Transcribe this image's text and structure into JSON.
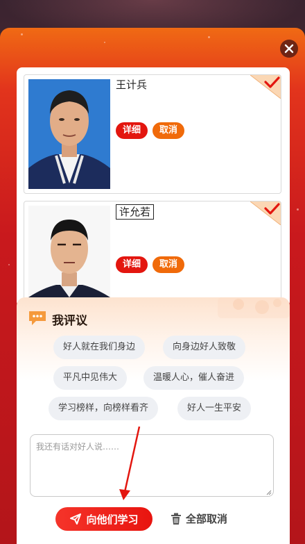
{
  "candidates": [
    {
      "name": "王计兵",
      "detail_label": "详细",
      "cancel_label": "取消",
      "selected": true
    },
    {
      "name": "许允若",
      "detail_label": "详细",
      "cancel_label": "取消",
      "selected": true
    }
  ],
  "review": {
    "title": "我评议",
    "chips": [
      "好人就在我们身边",
      "向身边好人致敬",
      "平凡中见伟大",
      "温暖人心，催人奋进",
      "学习榜样，向榜样看齐",
      "好人一生平安"
    ],
    "comment_placeholder": "我还有话对好人说……",
    "comment_value": "",
    "submit_label": "向他们学习",
    "clear_label": "全部取消"
  },
  "colors": {
    "accent_red": "#e3160f",
    "accent_orange": "#f06a0a",
    "panel_top": "#f06a14",
    "panel_bottom": "#b3151a"
  },
  "icons": {
    "close": "close-icon",
    "check": "check-icon",
    "chat": "chat-bubble-icon",
    "send": "paper-plane-icon",
    "trash": "trash-icon"
  }
}
